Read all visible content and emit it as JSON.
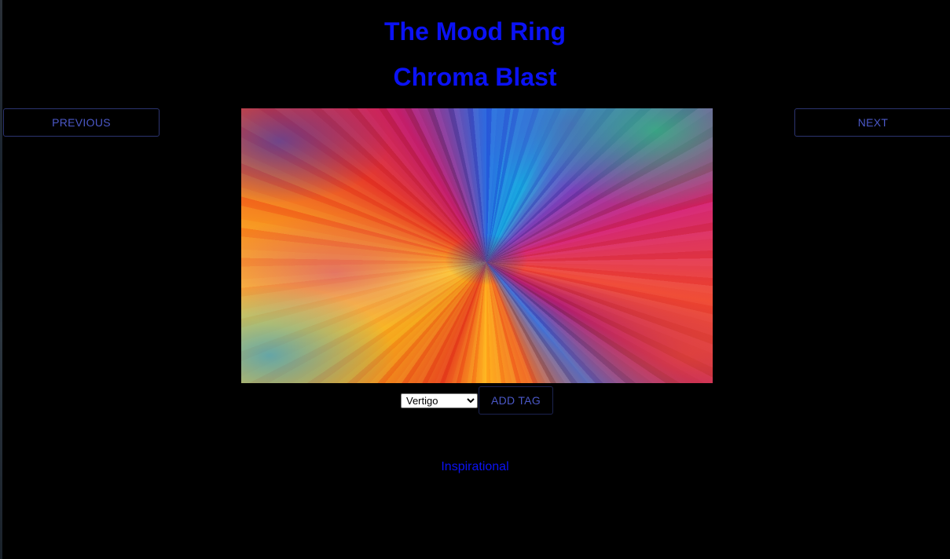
{
  "header": {
    "app_title": "The Mood Ring",
    "image_title": "Chroma Blast"
  },
  "navigation": {
    "previous_label": "PREVIOUS",
    "next_label": "NEXT"
  },
  "artwork": {
    "alt": "Chroma Blast"
  },
  "tagging": {
    "selected_tag": "Vertigo",
    "add_tag_label": "ADD TAG",
    "tags": [
      "Inspirational"
    ]
  },
  "colors": {
    "background": "#000000",
    "title": "#0b12f5",
    "button_text": "#4b58c7",
    "button_border": "#2c3470"
  }
}
